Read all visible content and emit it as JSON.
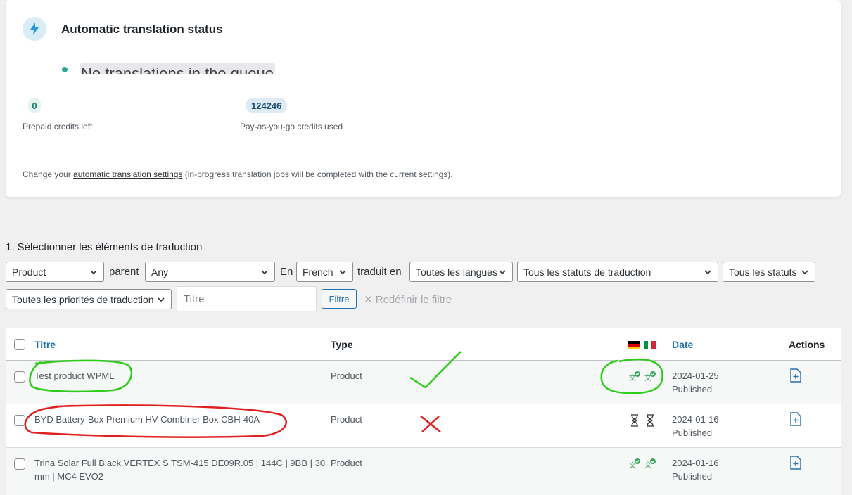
{
  "status_card": {
    "title": "Automatic translation status",
    "queue_text": "No translations in the queue",
    "prepaid": {
      "value": "0",
      "label": "Prepaid credits left"
    },
    "payg": {
      "value": "124246",
      "label": "Pay-as-you-go credits used"
    },
    "note_before": "Change your ",
    "note_link": "automatic translation settings",
    "note_after": " (in-progress translation jobs will be completed with the current settings)."
  },
  "filters": {
    "section_title": "1. Sélectionner les éléments de traduction",
    "type_select": "Product",
    "parent_label": "parent",
    "parent_select": "Any",
    "en_label": "En",
    "language_select": "French",
    "translated_in_label": "traduit en",
    "target_languages_select": "Toutes les langues",
    "translation_status_select": "Tous les statuts de traduction",
    "status_select": "Tous les statuts",
    "priority_select": "Toutes les priorités de traduction",
    "title_placeholder": "Titre",
    "filter_button": "Filtre",
    "reset_label": "Redéfinir le filtre"
  },
  "table": {
    "headers": {
      "title": "Titre",
      "type": "Type",
      "date": "Date",
      "actions": "Actions"
    },
    "rows": [
      {
        "title": "Test product WPML",
        "type": "Product",
        "date": "2024-01-25",
        "status": "Published",
        "translation_state": "translated"
      },
      {
        "title": "BYD Battery-Box Premium HV Combiner Box CBH-40A",
        "type": "Product",
        "date": "2024-01-16",
        "status": "Published",
        "translation_state": "waiting"
      },
      {
        "title_line1": "Trina Solar Full Black VERTEX S TSM-415 DE09R.05 | 144C | 9BB | 30",
        "title_line2": "mm | MC4 EVO2",
        "type": "Product",
        "date": "2024-01-16",
        "status": "Published",
        "translation_state": "translated"
      }
    ]
  },
  "colors": {
    "accent": "#2271b1",
    "annotation_green": "#2ecc1a",
    "annotation_red": "#e02020",
    "translated_green": "#3aa55b"
  }
}
